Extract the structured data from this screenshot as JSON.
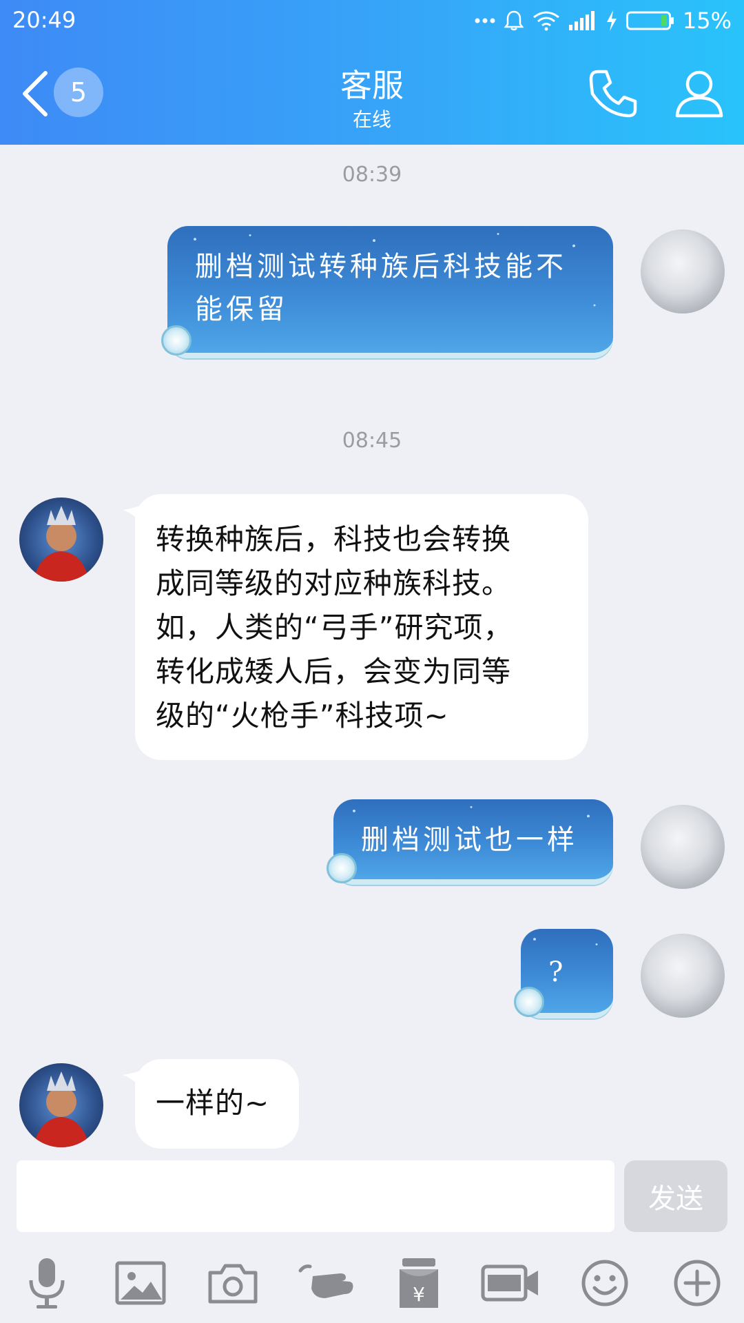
{
  "status_bar": {
    "time": "20:49",
    "battery_percent": "15%",
    "battery_level": 0.15
  },
  "header": {
    "unread_count": "5",
    "title": "客服",
    "subtitle": "在线"
  },
  "messages": [
    {
      "type": "timestamp",
      "text": "08:39"
    },
    {
      "type": "outgoing",
      "lines": [
        "删档测试转种族后科技能不",
        "能保留"
      ]
    },
    {
      "type": "timestamp",
      "text": "08:45"
    },
    {
      "type": "incoming",
      "lines": [
        "转换种族后，科技也会转换",
        "成同等级的对应种族科技。",
        "如，人类的“弓手”研究项，",
        "转化成矮人后，会变为同等",
        "级的“火枪手”科技项~"
      ]
    },
    {
      "type": "outgoing",
      "lines": [
        "删档测试也一样"
      ]
    },
    {
      "type": "outgoing",
      "lines": [
        "?"
      ]
    },
    {
      "type": "incoming",
      "lines": [
        "一样的~"
      ]
    }
  ],
  "input": {
    "value": "",
    "send_label": "发送"
  },
  "toolbar": [
    {
      "icon": "microphone-icon"
    },
    {
      "icon": "image-icon"
    },
    {
      "icon": "camera-icon"
    },
    {
      "icon": "poke-hand-icon"
    },
    {
      "icon": "red-packet-icon"
    },
    {
      "icon": "gif-icon"
    },
    {
      "icon": "emoji-icon"
    },
    {
      "icon": "plus-icon"
    }
  ],
  "colors": {
    "header_start": "#3e8af6",
    "header_end": "#29c3fb",
    "background": "#eff0f5",
    "self_bubble": "#3d8ad6"
  }
}
